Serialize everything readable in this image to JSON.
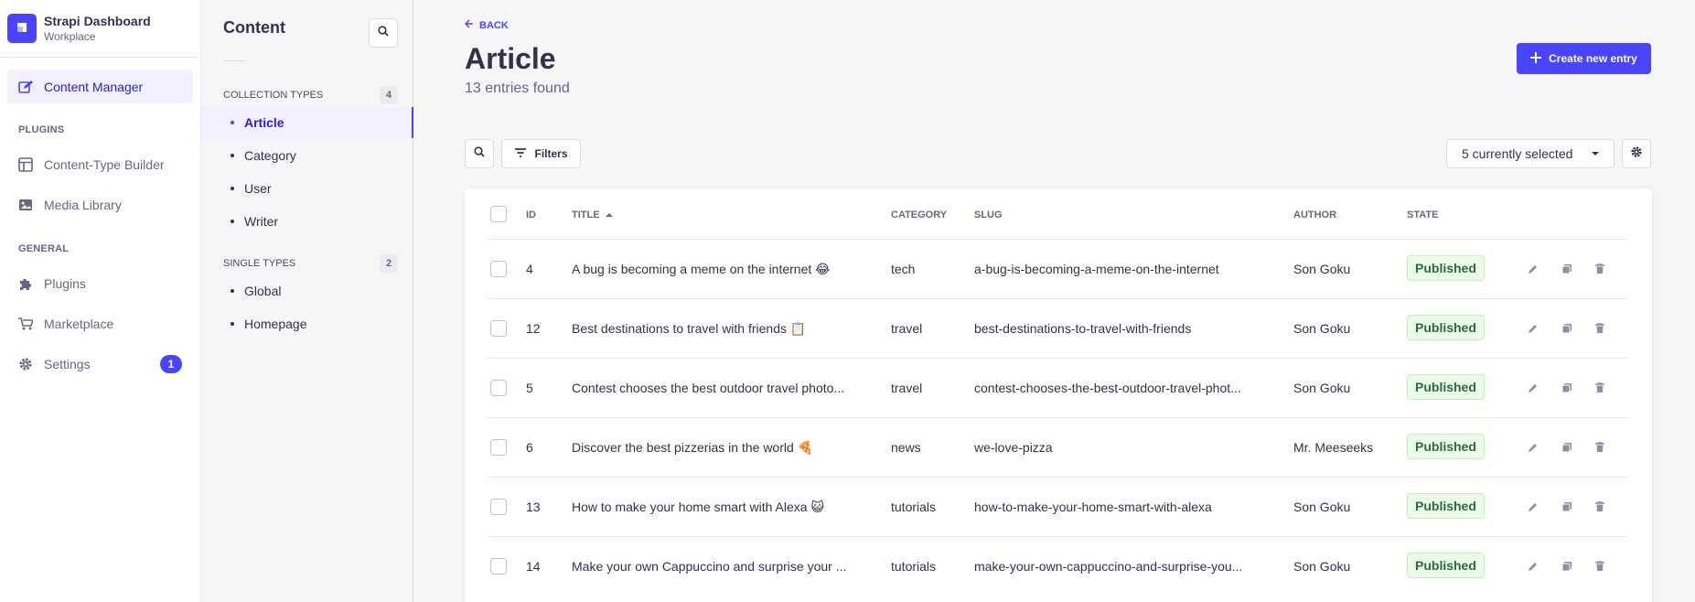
{
  "brand": {
    "title": "Strapi Dashboard",
    "subtitle": "Workplace"
  },
  "mainnav": {
    "content_manager": "Content Manager",
    "plugins_section": "PLUGINS",
    "content_type_builder": "Content-Type Builder",
    "media_library": "Media Library",
    "general_section": "GENERAL",
    "plugins": "Plugins",
    "marketplace": "Marketplace",
    "settings": "Settings",
    "settings_badge": "1"
  },
  "subnav": {
    "title": "Content",
    "collection_types_label": "COLLECTION TYPES",
    "collection_types_count": "4",
    "collection_types": [
      "Article",
      "Category",
      "User",
      "Writer"
    ],
    "single_types_label": "SINGLE TYPES",
    "single_types_count": "2",
    "single_types": [
      "Global",
      "Homepage"
    ]
  },
  "header": {
    "back": "BACK",
    "title": "Article",
    "subtitle": "13 entries found",
    "create_button": "Create new entry"
  },
  "toolbar": {
    "filters": "Filters",
    "columns_select": "5 currently selected"
  },
  "table": {
    "columns": [
      "ID",
      "TITLE",
      "CATEGORY",
      "SLUG",
      "AUTHOR",
      "STATE"
    ],
    "rows": [
      {
        "id": "4",
        "title": "A bug is becoming a meme on the internet 😂",
        "category": "tech",
        "slug": "a-bug-is-becoming-a-meme-on-the-internet",
        "author": "Son Goku",
        "state": "Published"
      },
      {
        "id": "12",
        "title": "Best destinations to travel with friends 📋",
        "category": "travel",
        "slug": "best-destinations-to-travel-with-friends",
        "author": "Son Goku",
        "state": "Published"
      },
      {
        "id": "5",
        "title": "Contest chooses the best outdoor travel photo...",
        "category": "travel",
        "slug": "contest-chooses-the-best-outdoor-travel-phot...",
        "author": "Son Goku",
        "state": "Published"
      },
      {
        "id": "6",
        "title": "Discover the best pizzerias in the world 🍕",
        "category": "news",
        "slug": "we-love-pizza",
        "author": "Mr. Meeseeks",
        "state": "Published"
      },
      {
        "id": "13",
        "title": "How to make your home smart with Alexa 😺",
        "category": "tutorials",
        "slug": "how-to-make-your-home-smart-with-alexa",
        "author": "Son Goku",
        "state": "Published"
      },
      {
        "id": "14",
        "title": "Make your own Cappuccino and surprise your ...",
        "category": "tutorials",
        "slug": "make-your-own-cappuccino-and-surprise-you...",
        "author": "Son Goku",
        "state": "Published"
      }
    ]
  },
  "colors": {
    "accent": "#4945ff",
    "published_bg": "#eafbe7",
    "published_text": "#2f6846"
  },
  "icons": [
    "strapi-logo-icon",
    "content-manager-icon",
    "layout-icon",
    "image-icon",
    "puzzle-icon",
    "cart-icon",
    "gear-icon",
    "search-icon",
    "filter-icon",
    "arrow-left-icon",
    "plus-icon",
    "sort-up-icon",
    "pencil-icon",
    "duplicate-icon",
    "trash-icon"
  ]
}
